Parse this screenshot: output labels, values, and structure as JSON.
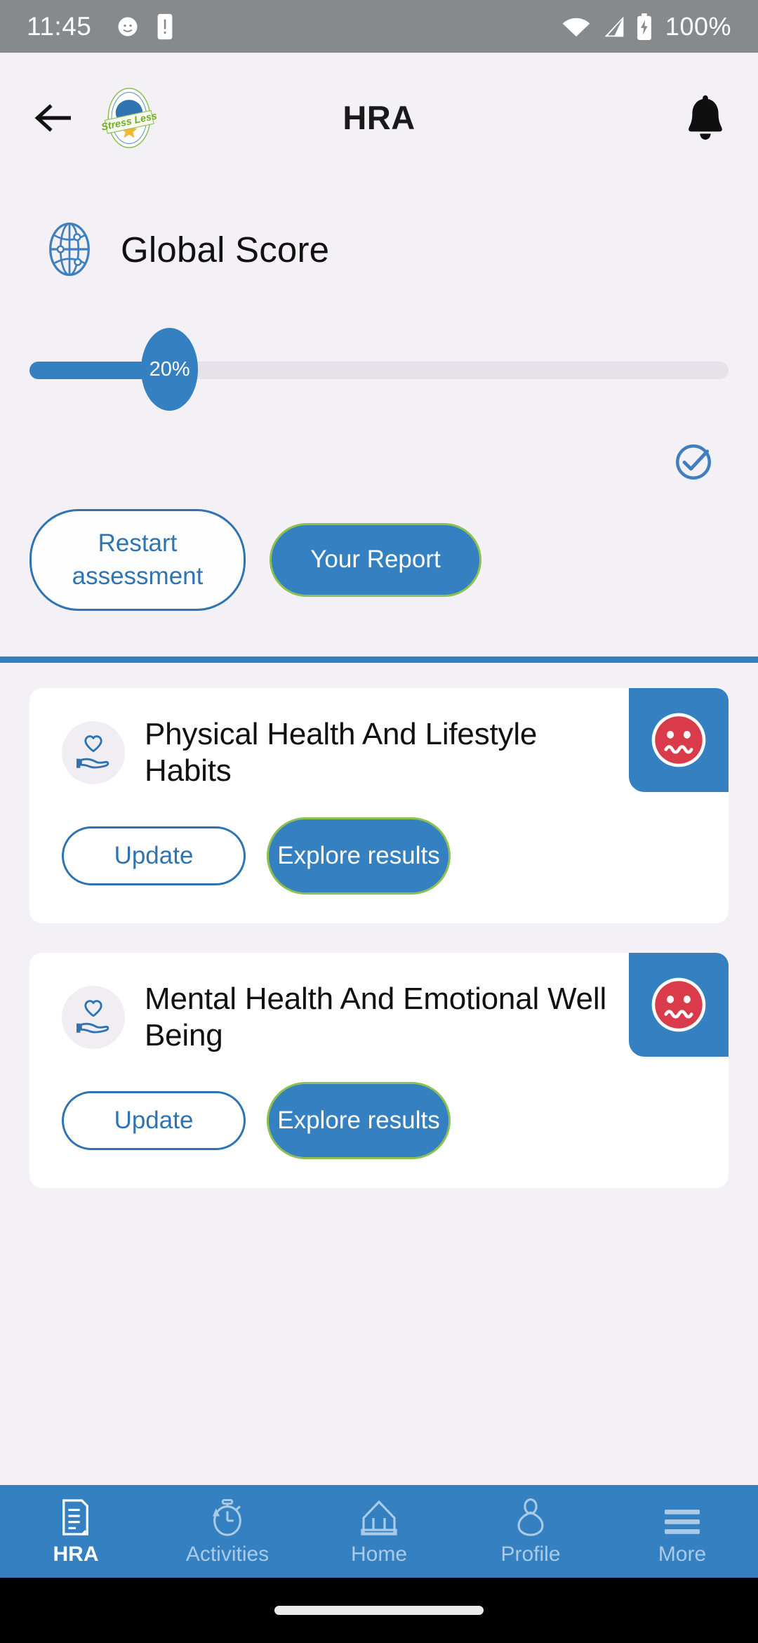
{
  "status_bar": {
    "time": "11:45",
    "battery_percent": "100%",
    "icons": [
      "cat-notification-icon",
      "phone-vibrate-icon",
      "wifi-icon",
      "cellular-signal-icon",
      "battery-charging-icon"
    ]
  },
  "app_bar": {
    "back_label": "back-arrow-icon",
    "logo_text": "Stress Less",
    "title": "HRA",
    "bell_label": "notification-bell-icon"
  },
  "global_score": {
    "title": "Global Score",
    "icon": "globe-icon",
    "percent_label": "20%",
    "percent_value": 20,
    "completed_icon": "check-circle-icon",
    "restart_button": "Restart assessment",
    "report_button": "Your Report"
  },
  "cards": [
    {
      "icon": "heart-in-hand-icon",
      "title": "Physical Health And Lifestyle Habits",
      "status_face": "worried-face-icon",
      "update_button": "Update",
      "explore_button": "Explore results"
    },
    {
      "icon": "heart-in-hand-icon",
      "title": "Mental Health And Emotional Well Being",
      "status_face": "worried-face-icon",
      "update_button": "Update",
      "explore_button": "Explore results"
    }
  ],
  "bottom_nav": [
    {
      "label": "HRA",
      "icon": "document-icon",
      "active": true
    },
    {
      "label": "Activities",
      "icon": "stopwatch-icon",
      "active": false
    },
    {
      "label": "Home",
      "icon": "house-icon",
      "active": false
    },
    {
      "label": "Profile",
      "icon": "person-icon",
      "active": false
    },
    {
      "label": "More",
      "icon": "hamburger-menu-icon",
      "active": false
    }
  ],
  "colors": {
    "brand_blue": "#3480c0",
    "accent_green": "#8cc152",
    "status_red": "#d93b4a",
    "page_background": "#f3f1f5",
    "status_bar": "#878a8d"
  }
}
